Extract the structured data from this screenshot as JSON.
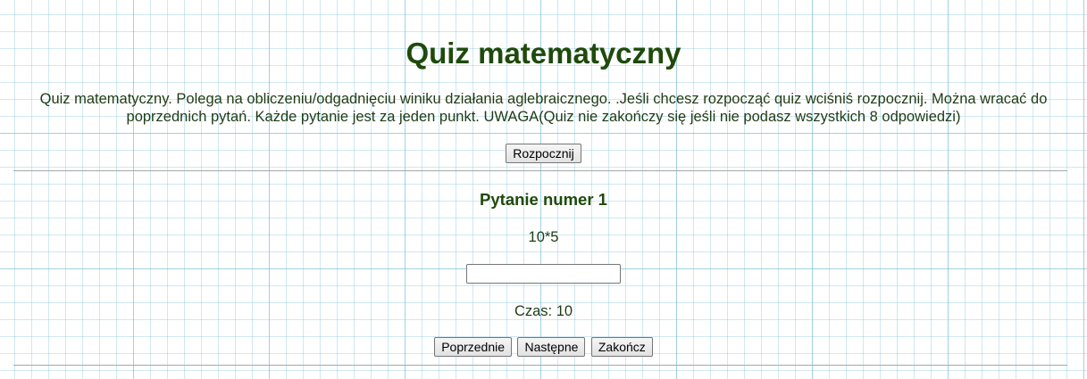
{
  "page": {
    "title": "Quiz matematyczny",
    "intro": "Quiz matematyczny. Polega na obliczeniu/odgadnięciu winiku działania aglebraicznego. .Jeśli chcesz rozpocząć quiz wciśniś rozpocznij. Można wracać do poprzednich pytań. Każde pytanie jest za jeden punkt. UWAGA(Quiz nie zakończy się jeśli nie podasz wszystkich 8 odpowiedzi)",
    "start_label": "Rozpocznij"
  },
  "question": {
    "heading": "Pytanie numer 1",
    "expression": "10*5",
    "answer_value": "",
    "timer_text": "Czas: 10"
  },
  "nav": {
    "prev_label": "Poprzednie",
    "next_label": "Następne",
    "finish_label": "Zakończ"
  },
  "colors": {
    "heading": "#1f4a0c",
    "text": "#1f3b14",
    "grid": "#78bed7"
  }
}
